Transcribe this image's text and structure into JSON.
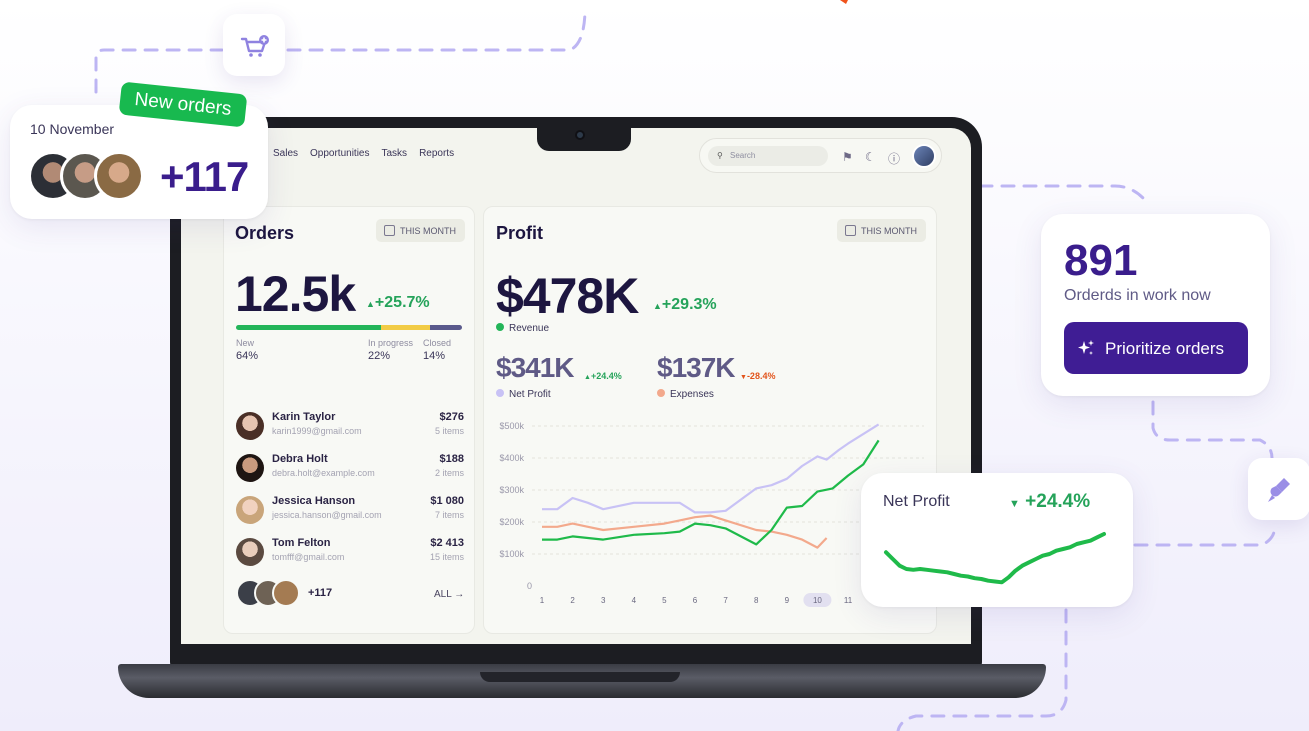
{
  "colors": {
    "accent": "#3f1d94",
    "positive": "#25a35a",
    "negative": "#e2541b",
    "new": "#23b559",
    "in_progress": "#f2cc45",
    "closed": "#5a5a8c",
    "net_profit_line": "#c8c2f5",
    "expenses_line": "#f3a98c",
    "revenue_line": "#1fba4a"
  },
  "nav": {
    "items": [
      "Sales",
      "Opportunities",
      "Tasks",
      "Reports"
    ]
  },
  "search": {
    "placeholder": "Search"
  },
  "orders": {
    "title": "Orders",
    "period": "THIS MONTH",
    "total": "12.5k",
    "change": "+25.7%",
    "segments": [
      {
        "label": "New",
        "value": "64%",
        "fraction": 0.64
      },
      {
        "label": "In progress",
        "value": "22%",
        "fraction": 0.22
      },
      {
        "label": "Closed",
        "value": "14%",
        "fraction": 0.14
      }
    ],
    "customers": [
      {
        "name": "Karin Taylor",
        "email": "karin1999@gmail.com",
        "amount": "$276",
        "items": "5 items"
      },
      {
        "name": "Debra Holt",
        "email": "debra.holt@example.com",
        "amount": "$188",
        "items": "2 items"
      },
      {
        "name": "Jessica Hanson",
        "email": "jessica.hanson@gmail.com",
        "amount": "$1 080",
        "items": "7 items"
      },
      {
        "name": "Tom Felton",
        "email": "tomfff@gmail.com",
        "amount": "$2 413",
        "items": "15 items"
      }
    ],
    "more": "+117",
    "all_label": "ALL"
  },
  "profit": {
    "title": "Profit",
    "period": "THIS MONTH",
    "total": "$478K",
    "change": "+29.3%",
    "revenue_label": "Revenue",
    "net": {
      "value": "$341K",
      "change": "+24.4%",
      "label": "Net Profit"
    },
    "expenses": {
      "value": "$137K",
      "change": "-28.4%",
      "label": "Expenses"
    }
  },
  "chart_data": {
    "type": "line",
    "x": [
      1,
      2,
      3,
      4,
      5,
      6,
      7,
      8,
      9,
      10,
      11
    ],
    "y_ticks": [
      "$500k",
      "$400k",
      "$300k",
      "$200k",
      "$100k",
      "0"
    ],
    "ylim": [
      0,
      500
    ],
    "highlight_x": "10",
    "series": [
      {
        "name": "Net Profit",
        "color": "#c8c2f5",
        "points": [
          [
            1,
            240
          ],
          [
            1.5,
            240
          ],
          [
            2,
            275
          ],
          [
            2.5,
            260
          ],
          [
            3,
            240
          ],
          [
            4,
            260
          ],
          [
            5,
            260
          ],
          [
            5.5,
            260
          ],
          [
            6,
            230
          ],
          [
            6.5,
            230
          ],
          [
            7,
            235
          ],
          [
            8,
            305
          ],
          [
            8.5,
            315
          ],
          [
            9,
            335
          ],
          [
            9.5,
            375
          ],
          [
            10,
            405
          ],
          [
            10.3,
            395
          ],
          [
            10.7,
            425
          ],
          [
            11,
            445
          ],
          [
            12,
            505
          ]
        ]
      },
      {
        "name": "Expenses",
        "color": "#f3a98c",
        "points": [
          [
            1,
            185
          ],
          [
            1.5,
            185
          ],
          [
            2,
            195
          ],
          [
            2.5,
            185
          ],
          [
            3,
            175
          ],
          [
            4,
            185
          ],
          [
            5,
            195
          ],
          [
            5.5,
            205
          ],
          [
            6,
            215
          ],
          [
            6.5,
            220
          ],
          [
            7,
            205
          ],
          [
            8,
            175
          ],
          [
            8.5,
            170
          ],
          [
            9,
            160
          ],
          [
            9.5,
            145
          ],
          [
            10,
            120
          ],
          [
            10.3,
            150
          ]
        ]
      },
      {
        "name": "Revenue",
        "color": "#1fba4a",
        "points": [
          [
            1,
            145
          ],
          [
            1.5,
            145
          ],
          [
            2,
            155
          ],
          [
            2.5,
            150
          ],
          [
            3,
            145
          ],
          [
            4,
            160
          ],
          [
            5,
            165
          ],
          [
            5.5,
            170
          ],
          [
            6,
            195
          ],
          [
            6.5,
            190
          ],
          [
            7,
            180
          ],
          [
            8,
            130
          ],
          [
            8.5,
            175
          ],
          [
            9,
            245
          ],
          [
            9.5,
            250
          ],
          [
            10,
            295
          ],
          [
            10.5,
            305
          ],
          [
            11,
            345
          ],
          [
            11.5,
            380
          ],
          [
            12,
            455
          ]
        ]
      }
    ]
  },
  "new_orders": {
    "badge": "New orders",
    "date": "10 November",
    "count": "+117"
  },
  "in_work": {
    "count": "891",
    "label": "Orderds in work now",
    "button": "Prioritize orders"
  },
  "net_profit_card": {
    "label": "Net Profit",
    "change": "+24.4%",
    "trend": [
      0.78,
      0.7,
      0.62,
      0.58,
      0.57,
      0.58,
      0.57,
      0.56,
      0.55,
      0.54,
      0.52,
      0.5,
      0.49,
      0.47,
      0.46,
      0.44,
      0.43,
      0.42,
      0.48,
      0.56,
      0.62,
      0.66,
      0.7,
      0.74,
      0.76,
      0.8,
      0.82,
      0.84,
      0.88,
      0.9,
      0.92,
      0.96,
      1.0
    ]
  }
}
